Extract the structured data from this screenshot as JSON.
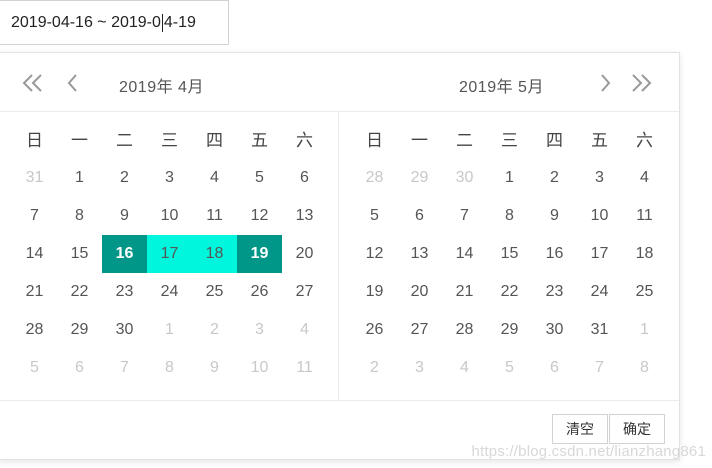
{
  "input": {
    "before_caret": "2019-04-16 ~ 2019-0",
    "after_caret": "4-19"
  },
  "header": {
    "left_title": "2019年  4月",
    "right_title": "2019年  5月"
  },
  "weekdays": [
    "日",
    "一",
    "二",
    "三",
    "四",
    "五",
    "六"
  ],
  "left_days": [
    {
      "d": "31",
      "o": true
    },
    {
      "d": "1"
    },
    {
      "d": "2"
    },
    {
      "d": "3"
    },
    {
      "d": "4"
    },
    {
      "d": "5"
    },
    {
      "d": "6"
    },
    {
      "d": "7"
    },
    {
      "d": "8"
    },
    {
      "d": "9"
    },
    {
      "d": "10"
    },
    {
      "d": "11"
    },
    {
      "d": "12"
    },
    {
      "d": "13"
    },
    {
      "d": "14"
    },
    {
      "d": "15"
    },
    {
      "d": "16",
      "s": "edge"
    },
    {
      "d": "17",
      "s": "range"
    },
    {
      "d": "18",
      "s": "range"
    },
    {
      "d": "19",
      "s": "edge"
    },
    {
      "d": "20"
    },
    {
      "d": "21"
    },
    {
      "d": "22"
    },
    {
      "d": "23"
    },
    {
      "d": "24"
    },
    {
      "d": "25"
    },
    {
      "d": "26"
    },
    {
      "d": "27"
    },
    {
      "d": "28"
    },
    {
      "d": "29"
    },
    {
      "d": "30"
    },
    {
      "d": "1",
      "o": true
    },
    {
      "d": "2",
      "o": true
    },
    {
      "d": "3",
      "o": true
    },
    {
      "d": "4",
      "o": true
    },
    {
      "d": "5",
      "o": true
    },
    {
      "d": "6",
      "o": true
    },
    {
      "d": "7",
      "o": true
    },
    {
      "d": "8",
      "o": true
    },
    {
      "d": "9",
      "o": true
    },
    {
      "d": "10",
      "o": true
    },
    {
      "d": "11",
      "o": true
    }
  ],
  "right_days": [
    {
      "d": "28",
      "o": true
    },
    {
      "d": "29",
      "o": true
    },
    {
      "d": "30",
      "o": true
    },
    {
      "d": "1"
    },
    {
      "d": "2"
    },
    {
      "d": "3"
    },
    {
      "d": "4"
    },
    {
      "d": "5"
    },
    {
      "d": "6"
    },
    {
      "d": "7"
    },
    {
      "d": "8"
    },
    {
      "d": "9"
    },
    {
      "d": "10"
    },
    {
      "d": "11"
    },
    {
      "d": "12"
    },
    {
      "d": "13"
    },
    {
      "d": "14"
    },
    {
      "d": "15"
    },
    {
      "d": "16"
    },
    {
      "d": "17"
    },
    {
      "d": "18"
    },
    {
      "d": "19"
    },
    {
      "d": "20"
    },
    {
      "d": "21"
    },
    {
      "d": "22"
    },
    {
      "d": "23"
    },
    {
      "d": "24"
    },
    {
      "d": "25"
    },
    {
      "d": "26"
    },
    {
      "d": "27"
    },
    {
      "d": "28"
    },
    {
      "d": "29"
    },
    {
      "d": "30"
    },
    {
      "d": "31"
    },
    {
      "d": "1",
      "o": true
    },
    {
      "d": "2",
      "o": true
    },
    {
      "d": "3",
      "o": true
    },
    {
      "d": "4",
      "o": true
    },
    {
      "d": "5",
      "o": true
    },
    {
      "d": "6",
      "o": true
    },
    {
      "d": "7",
      "o": true
    },
    {
      "d": "8",
      "o": true
    }
  ],
  "footer": {
    "clear_label": "清空",
    "confirm_label": "确定"
  },
  "watermark": "https://blog.csdn.net/lianzhang861",
  "colors": {
    "range_edge": "#009688",
    "range_inner": "#00f7de"
  },
  "icons": {
    "prev_year": "double-chevron-left-icon",
    "prev_month": "chevron-left-icon",
    "next_month": "chevron-right-icon",
    "next_year": "double-chevron-right-icon"
  }
}
